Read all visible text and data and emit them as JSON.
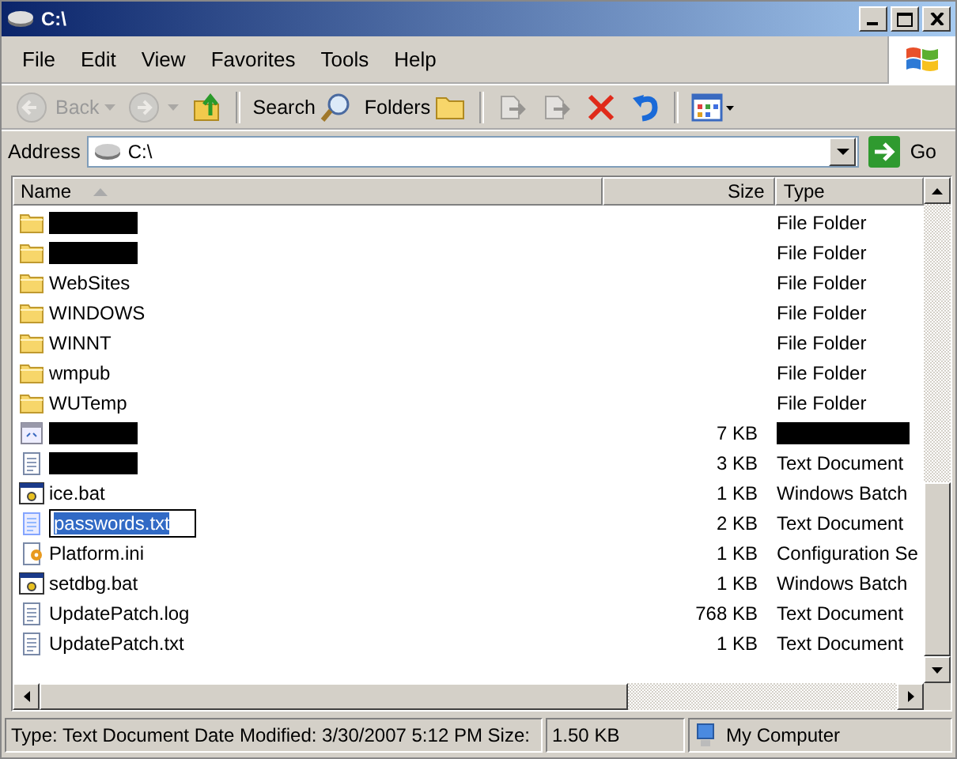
{
  "window": {
    "title": "C:\\"
  },
  "menu": [
    "File",
    "Edit",
    "View",
    "Favorites",
    "Tools",
    "Help"
  ],
  "toolbar": [
    {
      "kind": "back",
      "label": "Back",
      "disabled": true
    },
    {
      "kind": "forward",
      "disabled": true
    },
    {
      "kind": "up",
      "disabled": false
    },
    {
      "kind": "separator"
    },
    {
      "kind": "search",
      "label": "Search",
      "disabled": false
    },
    {
      "kind": "folders",
      "label": "Folders",
      "disabled": false
    },
    {
      "kind": "separator"
    },
    {
      "kind": "move",
      "disabled": true
    },
    {
      "kind": "copy",
      "disabled": true
    },
    {
      "kind": "delete",
      "disabled": false
    },
    {
      "kind": "undo",
      "disabled": false
    },
    {
      "kind": "separator"
    },
    {
      "kind": "views",
      "disabled": false
    }
  ],
  "address": {
    "label": "Address",
    "value": "C:\\",
    "go": "Go"
  },
  "table": {
    "columns": [
      {
        "label": "Name",
        "sorted": true
      },
      {
        "label": "Size",
        "sorted": false
      },
      {
        "label": "Type",
        "sorted": false
      }
    ],
    "rows": [
      {
        "kind": "folder",
        "type": "File Folder",
        "selected": false
      },
      {
        "kind": "folder",
        "type": "File Folder",
        "selected": false
      },
      {
        "kind": "folder",
        "name": "WebSites",
        "type": "File Folder",
        "selected": false
      },
      {
        "kind": "folder",
        "name": "WINDOWS",
        "type": "File Folder",
        "selected": false
      },
      {
        "kind": "folder",
        "name": "WINNT",
        "type": "File Folder",
        "selected": false
      },
      {
        "kind": "folder",
        "name": "wmpub",
        "type": "File Folder",
        "selected": false
      },
      {
        "kind": "folder",
        "name": "WUTemp",
        "type": "File Folder",
        "selected": false
      },
      {
        "kind": "app",
        "size": "7 KB",
        "selected": false
      },
      {
        "kind": "text",
        "size": "3 KB",
        "type": "Text Document",
        "selected": false
      },
      {
        "kind": "batch",
        "name": "ice.bat",
        "size": "1 KB",
        "type": "Windows Batch",
        "selected": false
      },
      {
        "kind": "text",
        "name": "passwords.txt",
        "size": "2 KB",
        "type": "Text Document",
        "selected": true
      },
      {
        "kind": "ini",
        "name": "Platform.ini",
        "size": "1 KB",
        "type": "Configuration Se",
        "selected": false
      },
      {
        "kind": "batch",
        "name": "setdbg.bat",
        "size": "1 KB",
        "type": "Windows Batch",
        "selected": false
      },
      {
        "kind": "text",
        "name": "UpdatePatch.log",
        "size": "768 KB",
        "type": "Text Document",
        "selected": false
      },
      {
        "kind": "text",
        "name": "UpdatePatch.txt",
        "size": "1 KB",
        "type": "Text Document",
        "selected": false
      }
    ]
  },
  "status_bar": {
    "details": "Type: Text Document Date Modified: 3/30/2007 5:12 PM Size:",
    "size": "1.50 KB",
    "zone": "My Computer"
  }
}
